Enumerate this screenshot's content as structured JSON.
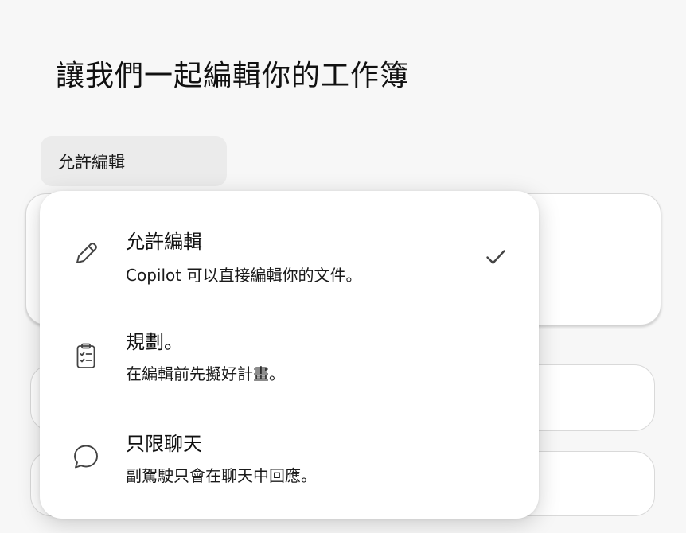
{
  "page": {
    "title": "讓我們一起編輯你的工作簿"
  },
  "dropdown": {
    "selected_label": "允許編輯"
  },
  "menu": {
    "items": [
      {
        "label": "允許編輯",
        "description": "Copilot 可以直接編輯你的文件。",
        "icon": "pencil-icon",
        "selected": true
      },
      {
        "label": "規劃。",
        "description": "在編輯前先擬好計畫。",
        "icon": "clipboard-checklist-icon",
        "selected": false
      },
      {
        "label": "只限聊天",
        "description": "副駕駛只會在聊天中回應。",
        "icon": "chat-bubble-icon",
        "selected": false
      }
    ]
  },
  "colors": {
    "background": "#f7f7f7",
    "menu_background": "#ffffff",
    "dropdown_background": "#ebebeb",
    "text": "#111111",
    "icon": "#444444"
  }
}
